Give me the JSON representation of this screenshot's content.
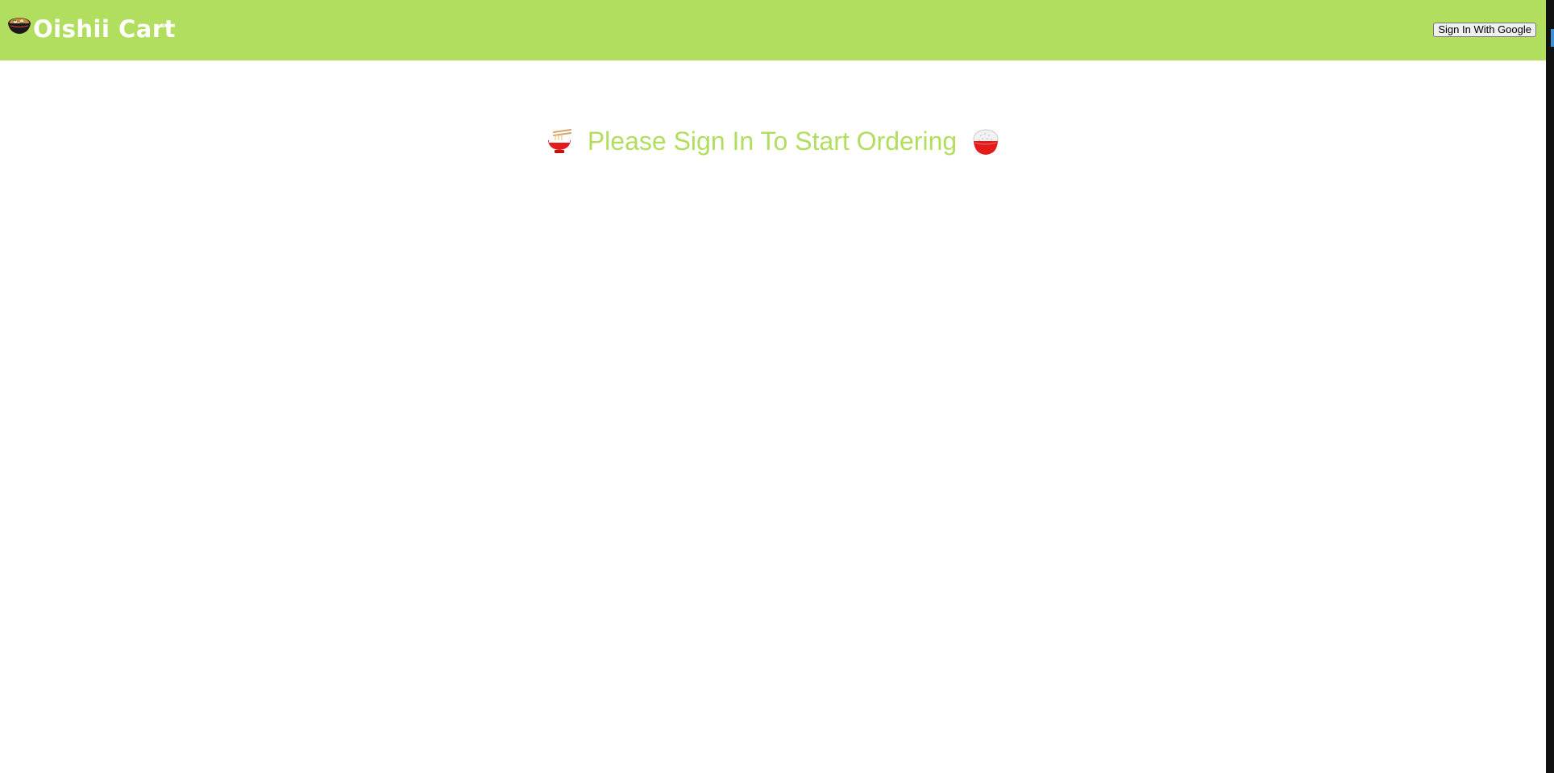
{
  "header": {
    "title": "Oishii Cart",
    "logo_icon": "miso-soup-bowl-icon",
    "signin_label": "Sign In With Google",
    "background_color": "#b2de5f"
  },
  "main": {
    "prompt_text": "Please Sign In To Start Ordering",
    "left_icon": "noodle-bowl-icon",
    "right_icon": "rice-bowl-icon",
    "text_color": "#b2de5f"
  }
}
